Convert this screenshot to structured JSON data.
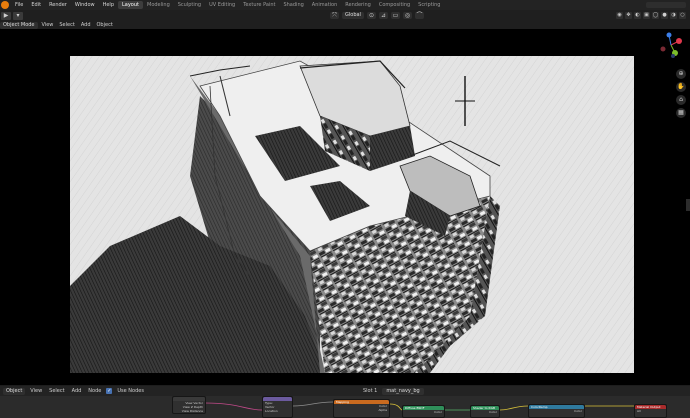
{
  "topbar": {
    "menus": [
      "File",
      "Edit",
      "Render",
      "Window",
      "Help"
    ],
    "workspaces": [
      "Layout",
      "Modeling",
      "Sculpting",
      "UV Editing",
      "Texture Paint",
      "Shading",
      "Animation",
      "Rendering",
      "Compositing",
      "Scripting"
    ],
    "active_workspace": "Layout"
  },
  "viewport_header": {
    "mode": "Object Mode",
    "menus": [
      "View",
      "Select",
      "Add",
      "Object"
    ],
    "orientation": "Global"
  },
  "node_editor": {
    "header": {
      "type": "Object",
      "menus": [
        "View",
        "Select",
        "Add",
        "Node"
      ],
      "use_nodes_label": "Use Nodes",
      "slot": "Slot 1",
      "material": "mat_navy_bg"
    },
    "nodes": [
      {
        "title": "",
        "rows": [
          "View Vector",
          "View Z Depth",
          "View Distance"
        ],
        "color": "#3a3a3a"
      },
      {
        "title": "",
        "rows": [
          "Type:",
          "Vector",
          "Location"
        ],
        "color": "#6b5a9e"
      },
      {
        "title": "Mapping",
        "rows": [
          "Color",
          "Alpha"
        ],
        "color": "#c96a1f"
      },
      {
        "title": "Diffuse BSDF",
        "rows": [
          "Color"
        ],
        "color": "#2f8f5a"
      },
      {
        "title": "Shader to RGB",
        "rows": [
          "Color"
        ],
        "color": "#2f8f5a"
      },
      {
        "title": "ColorRamp",
        "rows": [
          "Color"
        ],
        "color": "#2f7a9e"
      },
      {
        "title": "Material Output",
        "rows": [
          "All"
        ],
        "color": "#a82b2b"
      }
    ]
  },
  "colors": {
    "accent": "#4772b3",
    "logo": "#e87d0d",
    "gizmo_x": "#e0384c",
    "gizmo_y": "#7cbd2a",
    "gizmo_z": "#3c7ee8"
  }
}
